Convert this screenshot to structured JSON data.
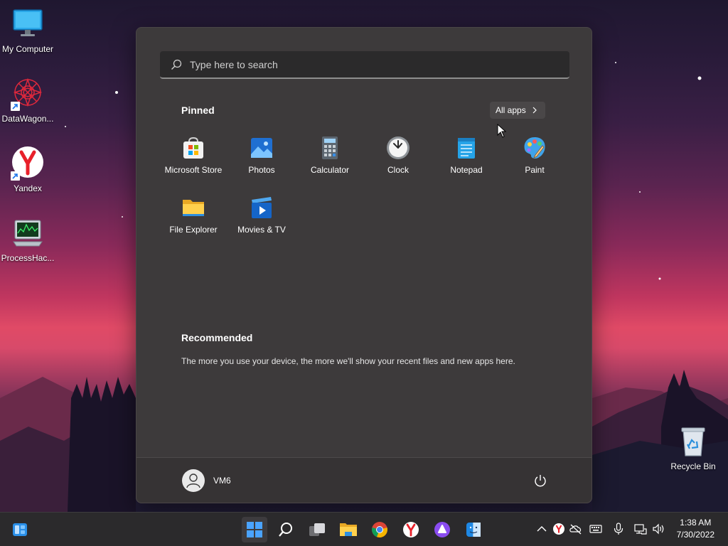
{
  "desktop": {
    "icons": [
      {
        "label": "My Computer",
        "icon": "monitor-icon"
      },
      {
        "label": "DataWagon...",
        "icon": "datawagon-icon"
      },
      {
        "label": "Yandex",
        "icon": "yandex-browser-icon"
      },
      {
        "label": "ProcessHac...",
        "icon": "processhacker-icon"
      },
      {
        "label": "Recycle Bin",
        "icon": "recycle-bin-icon"
      }
    ]
  },
  "start_menu": {
    "search_placeholder": "Type here to search",
    "pinned_title": "Pinned",
    "all_apps_label": "All apps",
    "pinned": [
      {
        "label": "Microsoft Store",
        "icon": "store-icon"
      },
      {
        "label": "Photos",
        "icon": "photos-icon"
      },
      {
        "label": "Calculator",
        "icon": "calculator-icon"
      },
      {
        "label": "Clock",
        "icon": "clock-icon"
      },
      {
        "label": "Notepad",
        "icon": "notepad-icon"
      },
      {
        "label": "Paint",
        "icon": "paint-icon"
      },
      {
        "label": "File Explorer",
        "icon": "folder-icon"
      },
      {
        "label": "Movies & TV",
        "icon": "movies-icon"
      }
    ],
    "recommended_title": "Recommended",
    "recommended_text": "The more you use your device, the more we'll show your recent files and new apps here.",
    "user_name": "VM6"
  },
  "taskbar": {
    "apps": [
      "widgets-icon",
      "start-icon",
      "search-icon",
      "task-view-icon",
      "file-explorer-icon",
      "chrome-icon",
      "yandex-icon",
      "alice-icon",
      "finder-icon"
    ],
    "time": "1:38 AM",
    "date": "7/30/2022"
  },
  "colors": {
    "menu_bg": "#3d3a3b",
    "taskbar_bg": "#2b2a2c",
    "accent": "#0078d4"
  }
}
